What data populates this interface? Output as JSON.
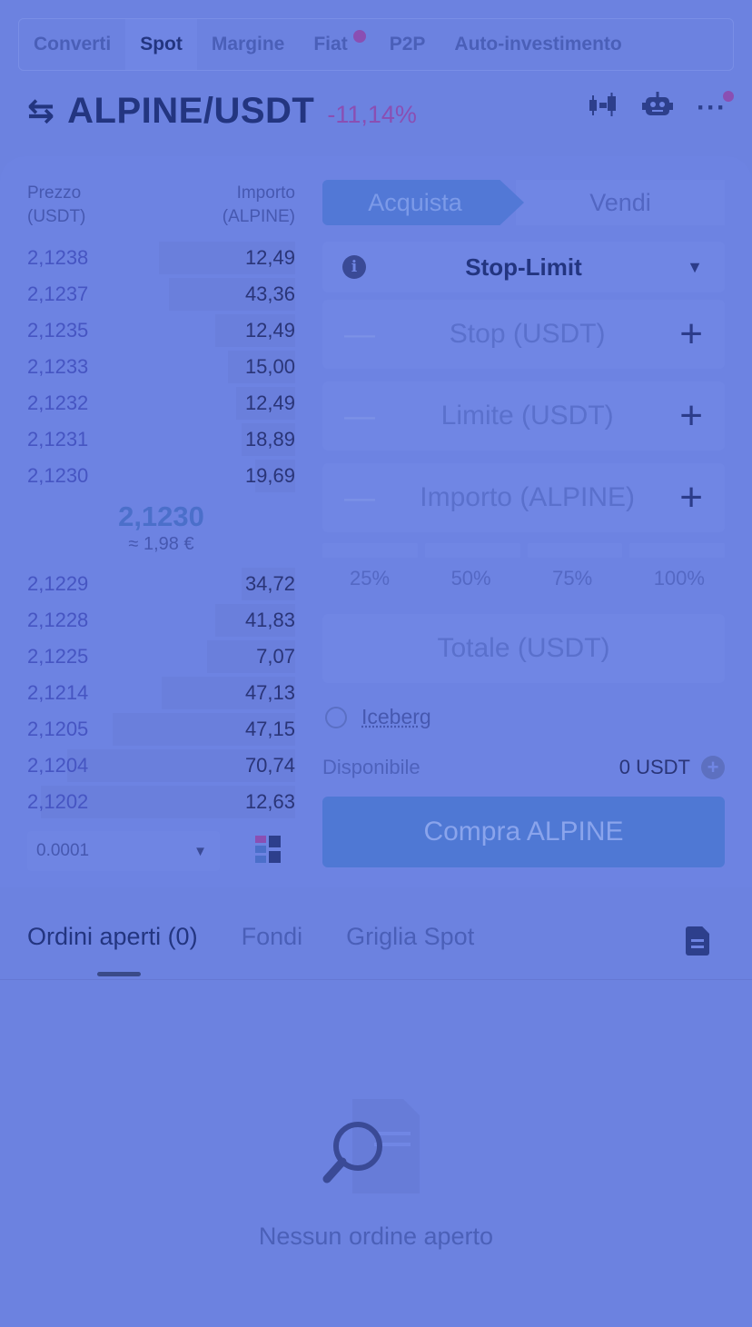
{
  "top_tabs": [
    {
      "label": "Converti"
    },
    {
      "label": "Spot"
    },
    {
      "label": "Margine"
    },
    {
      "label": "Fiat"
    },
    {
      "label": "P2P"
    },
    {
      "label": "Auto-investimento"
    }
  ],
  "header": {
    "pair": "ALPINE/USDT",
    "change": "-11,14%"
  },
  "order_book": {
    "price_header": "Prezzo",
    "price_unit": "(USDT)",
    "amount_header": "Importo",
    "amount_unit": "(ALPINE)",
    "asks": [
      {
        "price": "2,1238",
        "amount": "12,49",
        "depth": 0.51
      },
      {
        "price": "2,1237",
        "amount": "43,36",
        "depth": 0.47
      },
      {
        "price": "2,1235",
        "amount": "12,49",
        "depth": 0.3
      },
      {
        "price": "2,1233",
        "amount": "15,00",
        "depth": 0.25
      },
      {
        "price": "2,1232",
        "amount": "12,49",
        "depth": 0.22
      },
      {
        "price": "2,1231",
        "amount": "18,89",
        "depth": 0.2
      },
      {
        "price": "2,1230",
        "amount": "19,69",
        "depth": 0.15
      }
    ],
    "mid_price": "2,1230",
    "mid_fiat": "≈ 1,98 €",
    "bids": [
      {
        "price": "2,1229",
        "amount": "34,72",
        "depth": 0.2
      },
      {
        "price": "2,1228",
        "amount": "41,83",
        "depth": 0.3
      },
      {
        "price": "2,1225",
        "amount": "7,07",
        "depth": 0.33
      },
      {
        "price": "2,1214",
        "amount": "47,13",
        "depth": 0.5
      },
      {
        "price": "2,1205",
        "amount": "47,15",
        "depth": 0.68
      },
      {
        "price": "2,1204",
        "amount": "70,74",
        "depth": 0.85
      },
      {
        "price": "2,1202",
        "amount": "12,63",
        "depth": 0.95
      }
    ],
    "precision": "0.0001"
  },
  "trade_form": {
    "buy_tab": "Acquista",
    "sell_tab": "Vendi",
    "order_type": "Stop-Limit",
    "stop_placeholder": "Stop (USDT)",
    "limit_placeholder": "Limite (USDT)",
    "amount_placeholder": "Importo (ALPINE)",
    "percentages": [
      "25%",
      "50%",
      "75%",
      "100%"
    ],
    "total_placeholder": "Totale (USDT)",
    "iceberg_label": "Iceberg",
    "available_label": "Disponibile",
    "available_value": "0 USDT",
    "buy_button": "Compra ALPINE"
  },
  "bottom_tabs": {
    "open_orders": "Ordini aperti (0)",
    "funds": "Fondi",
    "grid": "Griglia Spot"
  },
  "empty_state": "Nessun ordine aperto",
  "colors": {
    "background": "#6c82e0",
    "negative": "#8a4fb3",
    "buy": "#4f78d4"
  }
}
